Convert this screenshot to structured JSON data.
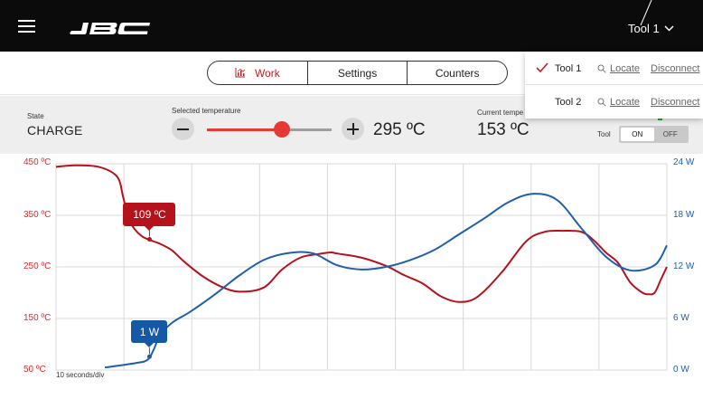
{
  "header": {
    "tool_selector": "Tool 1",
    "colors": {
      "background": "#0b0b0b",
      "text": "#ffffff"
    }
  },
  "tabs": [
    {
      "label": "Work",
      "active": true,
      "icon": "chart-icon"
    },
    {
      "label": "Settings",
      "active": false
    },
    {
      "label": "Counters",
      "active": false
    }
  ],
  "tool_menu": {
    "items": [
      {
        "name": "Tool 1",
        "selected": true,
        "locate": "Locate",
        "disconnect": "Disconnect"
      },
      {
        "name": "Tool 2",
        "selected": false,
        "locate": "Locate",
        "disconnect": "Disconnect"
      }
    ]
  },
  "controls": {
    "state_label": "State",
    "state_value": "CHARGE",
    "selected_label": "Selected temperature",
    "selected_value": "295 ºC",
    "slider_fraction": 0.6,
    "current_label": "Current tempe",
    "current_value": "153 ºC",
    "tool_label": "Tool",
    "toggle_on": "ON",
    "toggle_off": "OFF",
    "toggle_state": "ON"
  },
  "chart_data": {
    "type": "line",
    "x_label": "10 seconds/div",
    "left_axis": {
      "ticks": [
        "450 ºC",
        "350 ºC",
        "250 ºC",
        "150 ºC",
        "50 ºC"
      ],
      "range": [
        50,
        450
      ],
      "color": "#c41e1e"
    },
    "right_axis": {
      "ticks": [
        "24 W",
        "18 W",
        "12 W",
        "6 W",
        "0 W"
      ],
      "range": [
        0,
        24
      ],
      "color": "#1f5faa"
    },
    "grid": true,
    "series": [
      {
        "axis": "left",
        "color": "#b5121b",
        "x": [
          0,
          3,
          7,
          10,
          11,
          12,
          14,
          17,
          19,
          21,
          24,
          27,
          30,
          34,
          37,
          40,
          43,
          45,
          46,
          50,
          54,
          57,
          60,
          63,
          66,
          69,
          73,
          77,
          80,
          83,
          86,
          88,
          90,
          92,
          94,
          96,
          97,
          98,
          99,
          100
        ],
        "y": [
          444,
          447,
          444,
          425,
          385,
          340,
          310,
          295,
          282,
          260,
          232,
          212,
          202,
          210,
          245,
          268,
          275,
          278,
          276,
          268,
          252,
          234,
          218,
          193,
          182,
          192,
          240,
          300,
          318,
          320,
          318,
          302,
          278,
          258,
          220,
          200,
          197,
          200,
          225,
          250
        ]
      },
      {
        "axis": "right",
        "color": "#1f5faa",
        "x": [
          8,
          13,
          15,
          16,
          17,
          19,
          22,
          26,
          30,
          34,
          38,
          42,
          46,
          50,
          54,
          58,
          62,
          66,
          70,
          74,
          78,
          82,
          86,
          90,
          94,
          98,
          100
        ],
        "y": [
          0.3,
          0.8,
          1.2,
          2.4,
          4,
          5.5,
          6.8,
          8.8,
          11,
          12.8,
          13.6,
          13.6,
          12.2,
          11.7,
          12,
          12.8,
          14,
          15.8,
          17.6,
          19.5,
          20.5,
          19.8,
          16.5,
          13.2,
          11.6,
          12.2,
          14.5
        ]
      }
    ],
    "callouts": [
      {
        "text": "109 ºC",
        "series": 0,
        "at_x": 15.3
      },
      {
        "text": "1 W",
        "series": 1,
        "at_x": 15.3
      }
    ]
  }
}
